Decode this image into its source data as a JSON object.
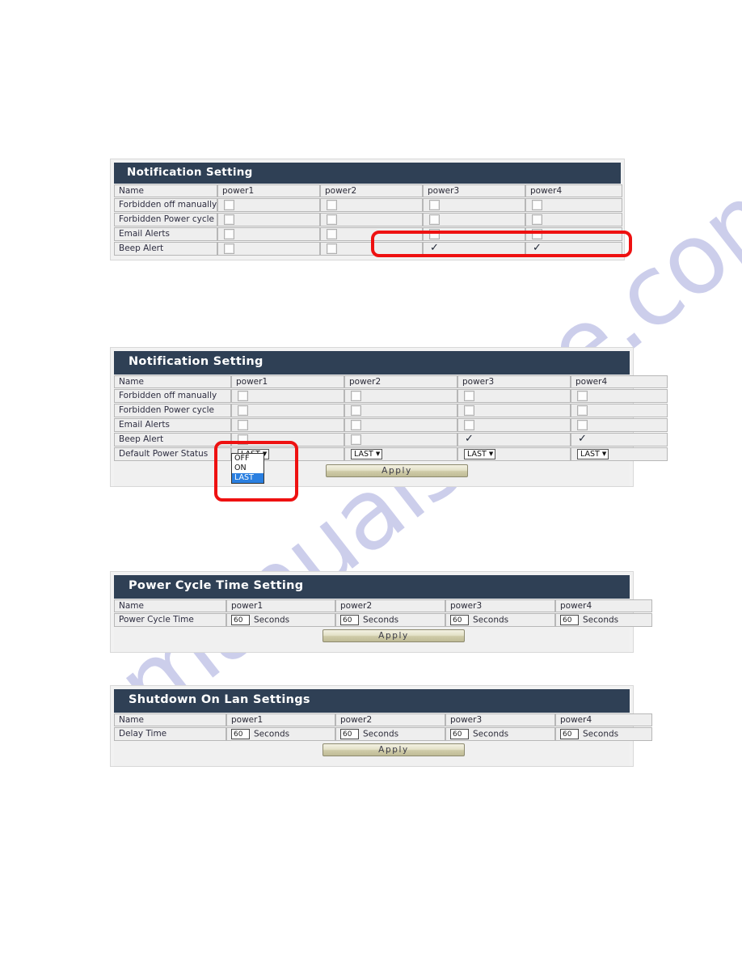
{
  "watermark": {
    "text": "manualshive.com"
  },
  "columns": {
    "name_header": "Name",
    "power1": "power1",
    "power2": "power2",
    "power3": "power3",
    "power4": "power4"
  },
  "panel1": {
    "title": "Notification Setting",
    "rows": [
      {
        "label": "Name",
        "type": "header",
        "values": [
          "power1",
          "power2",
          "power3",
          "power4"
        ]
      },
      {
        "label": "Forbidden off manually",
        "type": "checkbox",
        "values": [
          false,
          false,
          false,
          false
        ]
      },
      {
        "label": "Forbidden Power cycle",
        "type": "checkbox",
        "values": [
          false,
          false,
          false,
          false
        ]
      },
      {
        "label": "Email Alerts",
        "type": "checkbox",
        "values": [
          false,
          false,
          false,
          false
        ]
      },
      {
        "label": "Beep Alert",
        "type": "checkbox",
        "values": [
          false,
          false,
          true,
          true
        ]
      }
    ]
  },
  "panel2": {
    "title": "Notification Setting",
    "rows": [
      {
        "label": "Name",
        "type": "header",
        "values": [
          "power1",
          "power2",
          "power3",
          "power4"
        ]
      },
      {
        "label": "Forbidden off manually",
        "type": "checkbox",
        "values": [
          false,
          false,
          false,
          false
        ]
      },
      {
        "label": "Forbidden Power cycle",
        "type": "checkbox",
        "values": [
          false,
          false,
          false,
          false
        ]
      },
      {
        "label": "Email Alerts",
        "type": "checkbox",
        "values": [
          false,
          false,
          false,
          false
        ]
      },
      {
        "label": "Beep Alert",
        "type": "checkbox",
        "values": [
          false,
          false,
          true,
          true
        ]
      },
      {
        "label": "Default Power Status",
        "type": "select",
        "values": [
          "LAST",
          "LAST",
          "LAST",
          "LAST"
        ]
      }
    ],
    "select_options": [
      "OFF",
      "ON",
      "LAST"
    ],
    "select_selected": "LAST",
    "open_dropdown_column": 1,
    "apply_label": "Apply"
  },
  "panel3": {
    "title": "Power Cycle Time Setting",
    "rows": [
      {
        "label": "Name",
        "type": "header",
        "values": [
          "power1",
          "power2",
          "power3",
          "power4"
        ]
      },
      {
        "label": "Power Cycle Time",
        "type": "number",
        "values": [
          "60",
          "60",
          "60",
          "60"
        ],
        "unit": "Seconds"
      }
    ],
    "apply_label": "Apply"
  },
  "panel4": {
    "title": "Shutdown On Lan Settings",
    "rows": [
      {
        "label": "Name",
        "type": "header",
        "values": [
          "power1",
          "power2",
          "power3",
          "power4"
        ]
      },
      {
        "label": "Delay Time",
        "type": "number",
        "values": [
          "60",
          "60",
          "60",
          "60"
        ],
        "unit": "Seconds"
      }
    ],
    "apply_label": "Apply"
  },
  "annotations": {
    "highlight1": "beep-alert-power3-power4-highlight",
    "highlight2": "default-power-status-dropdown-highlight"
  },
  "colors": {
    "header_bar": "#2f4055",
    "annotation_red": "#ee1111",
    "dropdown_selected": "#2a7fe0",
    "panel_bg": "#f2f2f2"
  }
}
